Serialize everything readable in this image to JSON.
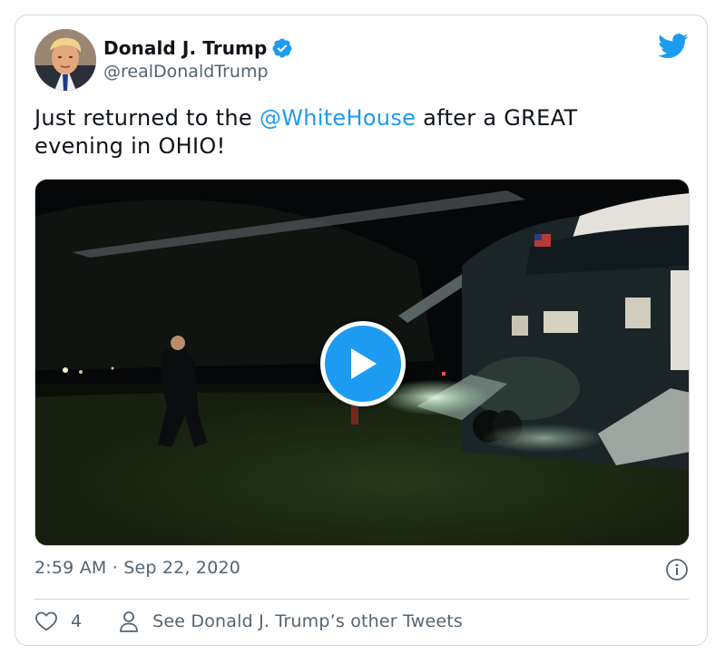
{
  "tweet": {
    "author_name": "Donald J. Trump",
    "handle": "@realDonaldTrump",
    "text_before": "Just returned to the ",
    "mention": "@WhiteHouse",
    "text_after": " after a GREAT evening in OHIO!",
    "timestamp": "2:59 AM · Sep 22, 2020",
    "like_count": "4",
    "other_tweets_label": "See Donald J. Trump’s other Tweets"
  },
  "icons": {
    "verified": "verified-badge-icon",
    "logo": "twitter-bird-icon",
    "play": "play-icon",
    "info": "info-icon",
    "like": "heart-icon",
    "profile": "person-icon"
  },
  "colors": {
    "accent": "#1d9bf0",
    "text": "#0f1419",
    "muted": "#536471",
    "border": "#cfd9de"
  }
}
